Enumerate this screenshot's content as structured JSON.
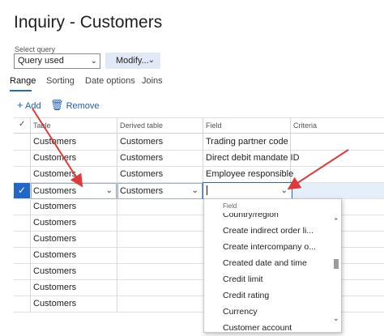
{
  "page": {
    "title": "Inquiry - Customers"
  },
  "query": {
    "label": "Select query",
    "selected": "Query used",
    "modify_label": "Modify..."
  },
  "tabs": [
    {
      "label": "Range",
      "active": true
    },
    {
      "label": "Sorting",
      "active": false
    },
    {
      "label": "Date options",
      "active": false
    },
    {
      "label": "Joins",
      "active": false
    }
  ],
  "toolbar": {
    "add_label": "Add",
    "remove_label": "Remove"
  },
  "grid": {
    "headers": {
      "table": "Table",
      "derived": "Derived table",
      "field": "Field",
      "criteria": "Criteria"
    },
    "rows": [
      {
        "table": "Customers",
        "derived": "Customers",
        "field": "Trading partner code",
        "criteria": ""
      },
      {
        "table": "Customers",
        "derived": "Customers",
        "field": "Direct debit mandate ID",
        "criteria": ""
      },
      {
        "table": "Customers",
        "derived": "Customers",
        "field": "Employee responsible",
        "criteria": ""
      },
      {
        "table": "Customers",
        "derived": "Customers",
        "field": "",
        "criteria": "",
        "selected": true
      },
      {
        "table": "Customers",
        "derived": "",
        "field": "",
        "criteria": ""
      },
      {
        "table": "Customers",
        "derived": "",
        "field": "",
        "criteria": ""
      },
      {
        "table": "Customers",
        "derived": "",
        "field": "",
        "criteria": ""
      },
      {
        "table": "Customers",
        "derived": "",
        "field": "",
        "criteria": ""
      },
      {
        "table": "Customers",
        "derived": "",
        "field": "",
        "criteria": ""
      },
      {
        "table": "Customers",
        "derived": "",
        "field": "",
        "criteria": ""
      },
      {
        "table": "Customers",
        "derived": "",
        "field": "",
        "criteria": ""
      }
    ]
  },
  "dropdown": {
    "header": "Field",
    "items": [
      "Country/region",
      "Create indirect order li...",
      "Create intercompany o...",
      "Created date and time",
      "Credit limit",
      "Credit rating",
      "Currency",
      "Customer account"
    ]
  },
  "colors": {
    "accent": "#2266c8",
    "selected_row": "#e5effa",
    "annotation_arrow": "#e0393a"
  },
  "icons": [
    "chevron-down-icon",
    "plus-icon",
    "trash-icon",
    "checkmark-icon",
    "chevron-up-icon",
    "pointer-arrow-icon"
  ]
}
